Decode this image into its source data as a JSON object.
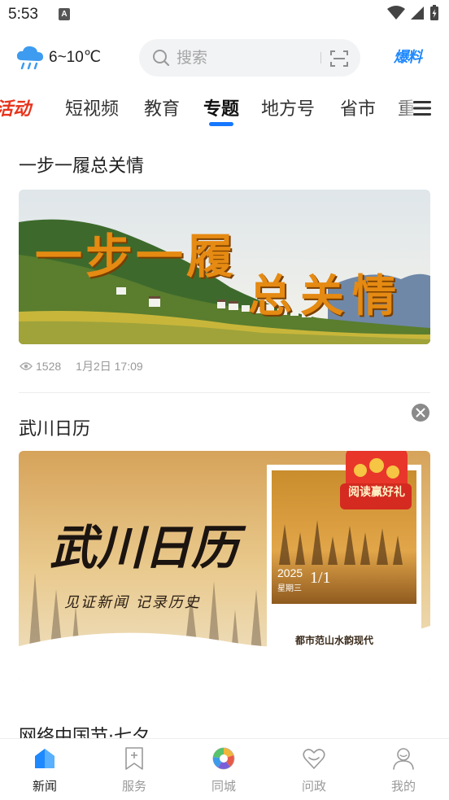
{
  "status_bar": {
    "time": "5:53",
    "notification_badge": "A"
  },
  "header": {
    "weather": {
      "temp": "6~10℃",
      "icon": "cloud-rain-icon"
    },
    "search": {
      "placeholder": "搜索",
      "icon": "search-icon",
      "scan_icon": "scan-icon"
    },
    "action_label": "爆料"
  },
  "tabs": {
    "items": [
      {
        "label": "活动"
      },
      {
        "label": "短视频"
      },
      {
        "label": "教育"
      },
      {
        "label": "专题"
      },
      {
        "label": "地方号"
      },
      {
        "label": "省市"
      },
      {
        "label": "重"
      }
    ],
    "active": "专题",
    "menu_icon": "hamburger-menu-icon"
  },
  "feed": {
    "items": [
      {
        "title": "一步一履总关情",
        "banner_text_1": "一步一履",
        "banner_text_2": "总关情",
        "views": "1528",
        "date": "1月2日 17:09"
      },
      {
        "title": "武川日历",
        "banner_title": "武川日历",
        "banner_subtitle": "见证新闻 记录历史",
        "reward_label": "阅读赢好礼",
        "calendar_year": "2025",
        "calendar_weekday": "星期三",
        "calendar_date": "1/1",
        "calendar_caption": "都市范山水韵现代"
      },
      {
        "title": "网络中国节·七夕"
      }
    ]
  },
  "bottom_nav": {
    "items": [
      {
        "label": "新闻",
        "icon": "home-news-icon",
        "active": true
      },
      {
        "label": "服务",
        "icon": "bookmark-plus-icon",
        "active": false
      },
      {
        "label": "同城",
        "icon": "aperture-icon",
        "active": false
      },
      {
        "label": "问政",
        "icon": "heart-icon",
        "active": false
      },
      {
        "label": "我的",
        "icon": "user-icon",
        "active": false
      }
    ]
  },
  "colors": {
    "accent": "#1677ff",
    "activity_red": "#e8331b",
    "banner_orange": "#e58a12",
    "reward_red": "#e8362b"
  }
}
